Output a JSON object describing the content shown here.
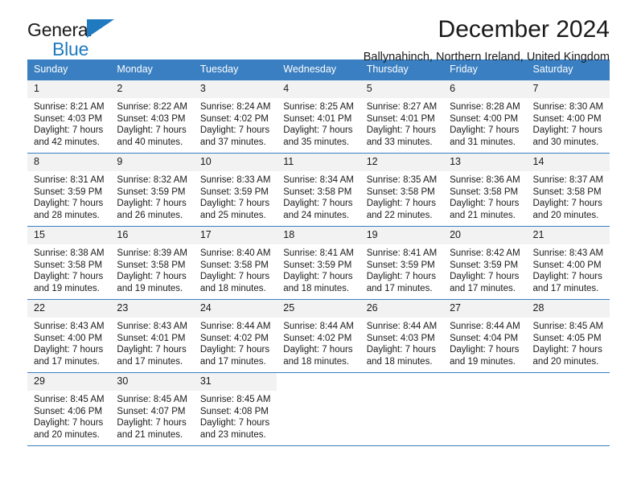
{
  "logo": {
    "word1": "General",
    "word2": "Blue",
    "triangle_color": "#1f7ac0"
  },
  "header": {
    "title": "December 2024",
    "subtitle": "Ballynahinch, Northern Ireland, United Kingdom"
  },
  "theme": {
    "header_bg": "#3a7fc1",
    "daynum_bg": "#f2f2f2",
    "text": "#1a1a1a",
    "accent": "#1f7ac0"
  },
  "weekdays": [
    "Sunday",
    "Monday",
    "Tuesday",
    "Wednesday",
    "Thursday",
    "Friday",
    "Saturday"
  ],
  "weeks": [
    [
      {
        "day": "1",
        "sunrise": "Sunrise: 8:21 AM",
        "sunset": "Sunset: 4:03 PM",
        "daylight1": "Daylight: 7 hours",
        "daylight2": "and 42 minutes."
      },
      {
        "day": "2",
        "sunrise": "Sunrise: 8:22 AM",
        "sunset": "Sunset: 4:03 PM",
        "daylight1": "Daylight: 7 hours",
        "daylight2": "and 40 minutes."
      },
      {
        "day": "3",
        "sunrise": "Sunrise: 8:24 AM",
        "sunset": "Sunset: 4:02 PM",
        "daylight1": "Daylight: 7 hours",
        "daylight2": "and 37 minutes."
      },
      {
        "day": "4",
        "sunrise": "Sunrise: 8:25 AM",
        "sunset": "Sunset: 4:01 PM",
        "daylight1": "Daylight: 7 hours",
        "daylight2": "and 35 minutes."
      },
      {
        "day": "5",
        "sunrise": "Sunrise: 8:27 AM",
        "sunset": "Sunset: 4:01 PM",
        "daylight1": "Daylight: 7 hours",
        "daylight2": "and 33 minutes."
      },
      {
        "day": "6",
        "sunrise": "Sunrise: 8:28 AM",
        "sunset": "Sunset: 4:00 PM",
        "daylight1": "Daylight: 7 hours",
        "daylight2": "and 31 minutes."
      },
      {
        "day": "7",
        "sunrise": "Sunrise: 8:30 AM",
        "sunset": "Sunset: 4:00 PM",
        "daylight1": "Daylight: 7 hours",
        "daylight2": "and 30 minutes."
      }
    ],
    [
      {
        "day": "8",
        "sunrise": "Sunrise: 8:31 AM",
        "sunset": "Sunset: 3:59 PM",
        "daylight1": "Daylight: 7 hours",
        "daylight2": "and 28 minutes."
      },
      {
        "day": "9",
        "sunrise": "Sunrise: 8:32 AM",
        "sunset": "Sunset: 3:59 PM",
        "daylight1": "Daylight: 7 hours",
        "daylight2": "and 26 minutes."
      },
      {
        "day": "10",
        "sunrise": "Sunrise: 8:33 AM",
        "sunset": "Sunset: 3:59 PM",
        "daylight1": "Daylight: 7 hours",
        "daylight2": "and 25 minutes."
      },
      {
        "day": "11",
        "sunrise": "Sunrise: 8:34 AM",
        "sunset": "Sunset: 3:58 PM",
        "daylight1": "Daylight: 7 hours",
        "daylight2": "and 24 minutes."
      },
      {
        "day": "12",
        "sunrise": "Sunrise: 8:35 AM",
        "sunset": "Sunset: 3:58 PM",
        "daylight1": "Daylight: 7 hours",
        "daylight2": "and 22 minutes."
      },
      {
        "day": "13",
        "sunrise": "Sunrise: 8:36 AM",
        "sunset": "Sunset: 3:58 PM",
        "daylight1": "Daylight: 7 hours",
        "daylight2": "and 21 minutes."
      },
      {
        "day": "14",
        "sunrise": "Sunrise: 8:37 AM",
        "sunset": "Sunset: 3:58 PM",
        "daylight1": "Daylight: 7 hours",
        "daylight2": "and 20 minutes."
      }
    ],
    [
      {
        "day": "15",
        "sunrise": "Sunrise: 8:38 AM",
        "sunset": "Sunset: 3:58 PM",
        "daylight1": "Daylight: 7 hours",
        "daylight2": "and 19 minutes."
      },
      {
        "day": "16",
        "sunrise": "Sunrise: 8:39 AM",
        "sunset": "Sunset: 3:58 PM",
        "daylight1": "Daylight: 7 hours",
        "daylight2": "and 19 minutes."
      },
      {
        "day": "17",
        "sunrise": "Sunrise: 8:40 AM",
        "sunset": "Sunset: 3:58 PM",
        "daylight1": "Daylight: 7 hours",
        "daylight2": "and 18 minutes."
      },
      {
        "day": "18",
        "sunrise": "Sunrise: 8:41 AM",
        "sunset": "Sunset: 3:59 PM",
        "daylight1": "Daylight: 7 hours",
        "daylight2": "and 18 minutes."
      },
      {
        "day": "19",
        "sunrise": "Sunrise: 8:41 AM",
        "sunset": "Sunset: 3:59 PM",
        "daylight1": "Daylight: 7 hours",
        "daylight2": "and 17 minutes."
      },
      {
        "day": "20",
        "sunrise": "Sunrise: 8:42 AM",
        "sunset": "Sunset: 3:59 PM",
        "daylight1": "Daylight: 7 hours",
        "daylight2": "and 17 minutes."
      },
      {
        "day": "21",
        "sunrise": "Sunrise: 8:43 AM",
        "sunset": "Sunset: 4:00 PM",
        "daylight1": "Daylight: 7 hours",
        "daylight2": "and 17 minutes."
      }
    ],
    [
      {
        "day": "22",
        "sunrise": "Sunrise: 8:43 AM",
        "sunset": "Sunset: 4:00 PM",
        "daylight1": "Daylight: 7 hours",
        "daylight2": "and 17 minutes."
      },
      {
        "day": "23",
        "sunrise": "Sunrise: 8:43 AM",
        "sunset": "Sunset: 4:01 PM",
        "daylight1": "Daylight: 7 hours",
        "daylight2": "and 17 minutes."
      },
      {
        "day": "24",
        "sunrise": "Sunrise: 8:44 AM",
        "sunset": "Sunset: 4:02 PM",
        "daylight1": "Daylight: 7 hours",
        "daylight2": "and 17 minutes."
      },
      {
        "day": "25",
        "sunrise": "Sunrise: 8:44 AM",
        "sunset": "Sunset: 4:02 PM",
        "daylight1": "Daylight: 7 hours",
        "daylight2": "and 18 minutes."
      },
      {
        "day": "26",
        "sunrise": "Sunrise: 8:44 AM",
        "sunset": "Sunset: 4:03 PM",
        "daylight1": "Daylight: 7 hours",
        "daylight2": "and 18 minutes."
      },
      {
        "day": "27",
        "sunrise": "Sunrise: 8:44 AM",
        "sunset": "Sunset: 4:04 PM",
        "daylight1": "Daylight: 7 hours",
        "daylight2": "and 19 minutes."
      },
      {
        "day": "28",
        "sunrise": "Sunrise: 8:45 AM",
        "sunset": "Sunset: 4:05 PM",
        "daylight1": "Daylight: 7 hours",
        "daylight2": "and 20 minutes."
      }
    ],
    [
      {
        "day": "29",
        "sunrise": "Sunrise: 8:45 AM",
        "sunset": "Sunset: 4:06 PM",
        "daylight1": "Daylight: 7 hours",
        "daylight2": "and 20 minutes."
      },
      {
        "day": "30",
        "sunrise": "Sunrise: 8:45 AM",
        "sunset": "Sunset: 4:07 PM",
        "daylight1": "Daylight: 7 hours",
        "daylight2": "and 21 minutes."
      },
      {
        "day": "31",
        "sunrise": "Sunrise: 8:45 AM",
        "sunset": "Sunset: 4:08 PM",
        "daylight1": "Daylight: 7 hours",
        "daylight2": "and 23 minutes."
      },
      {
        "day": "",
        "sunrise": "",
        "sunset": "",
        "daylight1": "",
        "daylight2": ""
      },
      {
        "day": "",
        "sunrise": "",
        "sunset": "",
        "daylight1": "",
        "daylight2": ""
      },
      {
        "day": "",
        "sunrise": "",
        "sunset": "",
        "daylight1": "",
        "daylight2": ""
      },
      {
        "day": "",
        "sunrise": "",
        "sunset": "",
        "daylight1": "",
        "daylight2": ""
      }
    ]
  ]
}
